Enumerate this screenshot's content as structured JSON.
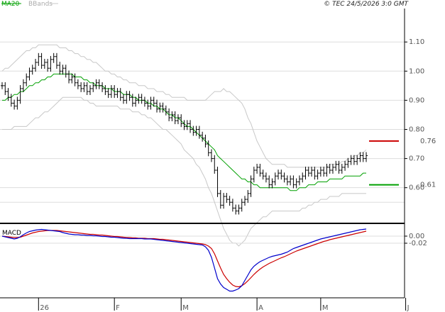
{
  "header": {
    "legend_ma20": "MA20",
    "legend_bbands": "BBands",
    "copyright": "© TEC 24/5/2026 3:0 GMT"
  },
  "macd_panel": {
    "label": "MACD"
  },
  "colors": {
    "background": "#ffffff",
    "grid": "#dddddd",
    "price_bars": "#000000",
    "ma20": "#00a000",
    "bbands": "#c8c8c8",
    "macd_line": "#0000cc",
    "signal_line": "#cc0000",
    "level_upper": "#cc0000",
    "level_lower": "#00a000",
    "axis": "#000000",
    "tick_text": "#555555"
  },
  "chart_data": [
    {
      "type": "ohlc",
      "name": "price",
      "xlabel": "",
      "ylabel": "",
      "ylim": [
        0.48,
        1.21
      ],
      "grid": true,
      "legend": "top-left",
      "x_tick_labels": [
        "26",
        "F",
        "M",
        "A",
        "M",
        "J"
      ],
      "y_tick_labels": [
        "1.10",
        "1.00",
        "0.90",
        "0.80",
        "0.70",
        "0.60"
      ],
      "y_tick_values": [
        1.1,
        1.0,
        0.9,
        0.8,
        0.7,
        0.6
      ],
      "bars_count": 121,
      "series": [
        {
          "name": "price",
          "values": [
            0.95,
            0.93,
            0.91,
            0.89,
            0.88,
            0.9,
            0.94,
            0.96,
            0.98,
            1.0,
            1.01,
            1.03,
            1.05,
            1.02,
            1.03,
            1.01,
            1.04,
            1.05,
            1.02,
            1.0,
            1.01,
            0.99,
            0.97,
            0.98,
            0.96,
            0.95,
            0.94,
            0.95,
            0.93,
            0.94,
            0.95,
            0.96,
            0.95,
            0.94,
            0.93,
            0.92,
            0.94,
            0.92,
            0.93,
            0.91,
            0.9,
            0.92,
            0.91,
            0.89,
            0.9,
            0.91,
            0.9,
            0.89,
            0.88,
            0.9,
            0.89,
            0.87,
            0.88,
            0.87,
            0.86,
            0.84,
            0.85,
            0.83,
            0.84,
            0.82,
            0.81,
            0.82,
            0.8,
            0.79,
            0.8,
            0.78,
            0.77,
            0.75,
            0.72,
            0.7,
            0.66,
            0.58,
            0.54,
            0.57,
            0.56,
            0.55,
            0.53,
            0.52,
            0.53,
            0.55,
            0.56,
            0.58,
            0.63,
            0.66,
            0.67,
            0.65,
            0.64,
            0.63,
            0.61,
            0.62,
            0.64,
            0.65,
            0.64,
            0.63,
            0.62,
            0.63,
            0.61,
            0.62,
            0.63,
            0.64,
            0.66,
            0.65,
            0.66,
            0.64,
            0.65,
            0.66,
            0.65,
            0.67,
            0.66,
            0.67,
            0.68,
            0.66,
            0.67,
            0.68,
            0.69,
            0.7,
            0.69,
            0.7,
            0.71,
            0.7,
            0.71
          ]
        },
        {
          "name": "MA20",
          "values": [
            0.9,
            0.9,
            0.91,
            0.91,
            0.92,
            0.92,
            0.93,
            0.93,
            0.94,
            0.95,
            0.95,
            0.96,
            0.96,
            0.97,
            0.97,
            0.98,
            0.98,
            0.99,
            0.99,
            0.99,
            0.99,
            0.99,
            0.99,
            0.99,
            0.98,
            0.98,
            0.98,
            0.97,
            0.97,
            0.96,
            0.96,
            0.95,
            0.95,
            0.95,
            0.94,
            0.94,
            0.94,
            0.93,
            0.93,
            0.93,
            0.92,
            0.92,
            0.92,
            0.91,
            0.91,
            0.9,
            0.9,
            0.9,
            0.89,
            0.89,
            0.88,
            0.88,
            0.87,
            0.87,
            0.86,
            0.85,
            0.85,
            0.84,
            0.84,
            0.83,
            0.82,
            0.81,
            0.81,
            0.8,
            0.79,
            0.78,
            0.77,
            0.76,
            0.75,
            0.74,
            0.73,
            0.71,
            0.7,
            0.69,
            0.68,
            0.67,
            0.66,
            0.65,
            0.64,
            0.63,
            0.63,
            0.62,
            0.62,
            0.61,
            0.61,
            0.6,
            0.6,
            0.6,
            0.6,
            0.6,
            0.6,
            0.6,
            0.6,
            0.6,
            0.6,
            0.59,
            0.59,
            0.59,
            0.6,
            0.6,
            0.6,
            0.61,
            0.61,
            0.61,
            0.62,
            0.62,
            0.62,
            0.62,
            0.63,
            0.63,
            0.63,
            0.63,
            0.63,
            0.64,
            0.64,
            0.64,
            0.64,
            0.64,
            0.64,
            0.65,
            0.65
          ]
        },
        {
          "name": "BBands",
          "upper": [
            1.0,
            1.01,
            1.01,
            1.02,
            1.03,
            1.04,
            1.05,
            1.06,
            1.07,
            1.07,
            1.08,
            1.08,
            1.09,
            1.09,
            1.09,
            1.09,
            1.09,
            1.09,
            1.09,
            1.08,
            1.08,
            1.08,
            1.07,
            1.07,
            1.06,
            1.06,
            1.05,
            1.05,
            1.04,
            1.04,
            1.03,
            1.03,
            1.02,
            1.01,
            1.0,
            1.0,
            0.99,
            0.99,
            0.98,
            0.98,
            0.97,
            0.97,
            0.96,
            0.96,
            0.96,
            0.95,
            0.95,
            0.95,
            0.94,
            0.94,
            0.94,
            0.93,
            0.93,
            0.93,
            0.92,
            0.92,
            0.91,
            0.91,
            0.91,
            0.91,
            0.91,
            0.9,
            0.9,
            0.9,
            0.9,
            0.9,
            0.9,
            0.9,
            0.91,
            0.92,
            0.93,
            0.93,
            0.93,
            0.94,
            0.93,
            0.93,
            0.92,
            0.91,
            0.9,
            0.89,
            0.87,
            0.84,
            0.82,
            0.79,
            0.76,
            0.74,
            0.72,
            0.7,
            0.69,
            0.68,
            0.68,
            0.68,
            0.68,
            0.68,
            0.67,
            0.67,
            0.67,
            0.67,
            0.67,
            0.67,
            0.67,
            0.67,
            0.67,
            0.67,
            0.67,
            0.67,
            0.67,
            0.67,
            0.68,
            0.68,
            0.68,
            0.68,
            0.69,
            0.69,
            0.7,
            0.7,
            0.71,
            0.71,
            0.72,
            0.72,
            0.73
          ],
          "lower": [
            0.8,
            0.8,
            0.8,
            0.8,
            0.81,
            0.81,
            0.81,
            0.81,
            0.81,
            0.82,
            0.83,
            0.84,
            0.84,
            0.85,
            0.86,
            0.86,
            0.87,
            0.88,
            0.89,
            0.9,
            0.91,
            0.91,
            0.91,
            0.91,
            0.91,
            0.91,
            0.91,
            0.9,
            0.9,
            0.89,
            0.89,
            0.88,
            0.88,
            0.88,
            0.88,
            0.88,
            0.88,
            0.88,
            0.88,
            0.87,
            0.87,
            0.87,
            0.87,
            0.86,
            0.86,
            0.86,
            0.85,
            0.85,
            0.84,
            0.84,
            0.83,
            0.82,
            0.81,
            0.8,
            0.8,
            0.79,
            0.78,
            0.77,
            0.76,
            0.75,
            0.73,
            0.72,
            0.71,
            0.7,
            0.68,
            0.67,
            0.65,
            0.63,
            0.6,
            0.58,
            0.55,
            0.52,
            0.49,
            0.46,
            0.44,
            0.42,
            0.41,
            0.41,
            0.4,
            0.41,
            0.42,
            0.44,
            0.46,
            0.47,
            0.48,
            0.49,
            0.5,
            0.5,
            0.51,
            0.52,
            0.52,
            0.52,
            0.52,
            0.52,
            0.52,
            0.52,
            0.52,
            0.52,
            0.52,
            0.53,
            0.53,
            0.54,
            0.54,
            0.55,
            0.55,
            0.56,
            0.56,
            0.56,
            0.57,
            0.57,
            0.57,
            0.57,
            0.58,
            0.58,
            0.58,
            0.58,
            0.58,
            0.58,
            0.58,
            0.58,
            0.58
          ]
        }
      ],
      "levels": [
        {
          "label": "0.76",
          "value": 0.76,
          "color": "#cc0000"
        },
        {
          "label": "0.61",
          "value": 0.61,
          "color": "#00a000"
        }
      ]
    },
    {
      "type": "line",
      "name": "MACD",
      "ylim": [
        -0.17,
        0.03
      ],
      "y_tick_labels": [
        "0.00",
        "-0.02"
      ],
      "y_tick_values": [
        0.0,
        -0.02
      ],
      "series": [
        {
          "name": "MACD",
          "values": [
            0.0,
            -0.002,
            -0.004,
            -0.006,
            -0.008,
            -0.006,
            -0.002,
            0.004,
            0.009,
            0.013,
            0.015,
            0.017,
            0.018,
            0.019,
            0.018,
            0.017,
            0.016,
            0.015,
            0.014,
            0.013,
            0.01,
            0.008,
            0.006,
            0.005,
            0.004,
            0.004,
            0.003,
            0.003,
            0.002,
            0.002,
            0.001,
            0.001,
            0.0,
            -0.001,
            -0.001,
            -0.002,
            -0.003,
            -0.003,
            -0.004,
            -0.005,
            -0.006,
            -0.006,
            -0.007,
            -0.007,
            -0.007,
            -0.007,
            -0.007,
            -0.008,
            -0.008,
            -0.008,
            -0.009,
            -0.01,
            -0.011,
            -0.012,
            -0.013,
            -0.014,
            -0.015,
            -0.016,
            -0.017,
            -0.018,
            -0.019,
            -0.02,
            -0.021,
            -0.022,
            -0.023,
            -0.024,
            -0.025,
            -0.03,
            -0.04,
            -0.06,
            -0.09,
            -0.12,
            -0.135,
            -0.145,
            -0.15,
            -0.155,
            -0.155,
            -0.152,
            -0.148,
            -0.14,
            -0.125,
            -0.11,
            -0.095,
            -0.085,
            -0.078,
            -0.072,
            -0.068,
            -0.064,
            -0.06,
            -0.057,
            -0.055,
            -0.053,
            -0.051,
            -0.048,
            -0.045,
            -0.04,
            -0.035,
            -0.032,
            -0.029,
            -0.026,
            -0.023,
            -0.02,
            -0.017,
            -0.014,
            -0.011,
            -0.008,
            -0.006,
            -0.004,
            -0.002,
            0.0,
            0.002,
            0.004,
            0.006,
            0.008,
            0.01,
            0.012,
            0.014,
            0.016,
            0.018,
            0.019,
            0.02
          ]
        },
        {
          "name": "Signal",
          "values": [
            0.0,
            -0.001,
            -0.002,
            -0.003,
            -0.004,
            -0.004,
            -0.003,
            0.0,
            0.003,
            0.006,
            0.009,
            0.011,
            0.013,
            0.014,
            0.015,
            0.016,
            0.016,
            0.016,
            0.016,
            0.015,
            0.014,
            0.013,
            0.012,
            0.011,
            0.01,
            0.009,
            0.008,
            0.007,
            0.006,
            0.005,
            0.005,
            0.004,
            0.003,
            0.003,
            0.002,
            0.001,
            0.0,
            -0.001,
            -0.001,
            -0.002,
            -0.003,
            -0.004,
            -0.004,
            -0.005,
            -0.005,
            -0.006,
            -0.006,
            -0.006,
            -0.007,
            -0.007,
            -0.007,
            -0.008,
            -0.009,
            -0.009,
            -0.01,
            -0.011,
            -0.012,
            -0.013,
            -0.014,
            -0.015,
            -0.016,
            -0.017,
            -0.018,
            -0.019,
            -0.02,
            -0.021,
            -0.022,
            -0.024,
            -0.028,
            -0.035,
            -0.05,
            -0.07,
            -0.09,
            -0.108,
            -0.12,
            -0.13,
            -0.138,
            -0.142,
            -0.143,
            -0.14,
            -0.134,
            -0.126,
            -0.117,
            -0.108,
            -0.1,
            -0.093,
            -0.087,
            -0.082,
            -0.077,
            -0.073,
            -0.069,
            -0.065,
            -0.061,
            -0.058,
            -0.054,
            -0.05,
            -0.046,
            -0.042,
            -0.039,
            -0.036,
            -0.033,
            -0.03,
            -0.027,
            -0.024,
            -0.021,
            -0.018,
            -0.015,
            -0.013,
            -0.01,
            -0.008,
            -0.006,
            -0.004,
            -0.002,
            0.0,
            0.002,
            0.004,
            0.006,
            0.008,
            0.01,
            0.012,
            0.014
          ]
        }
      ]
    }
  ]
}
